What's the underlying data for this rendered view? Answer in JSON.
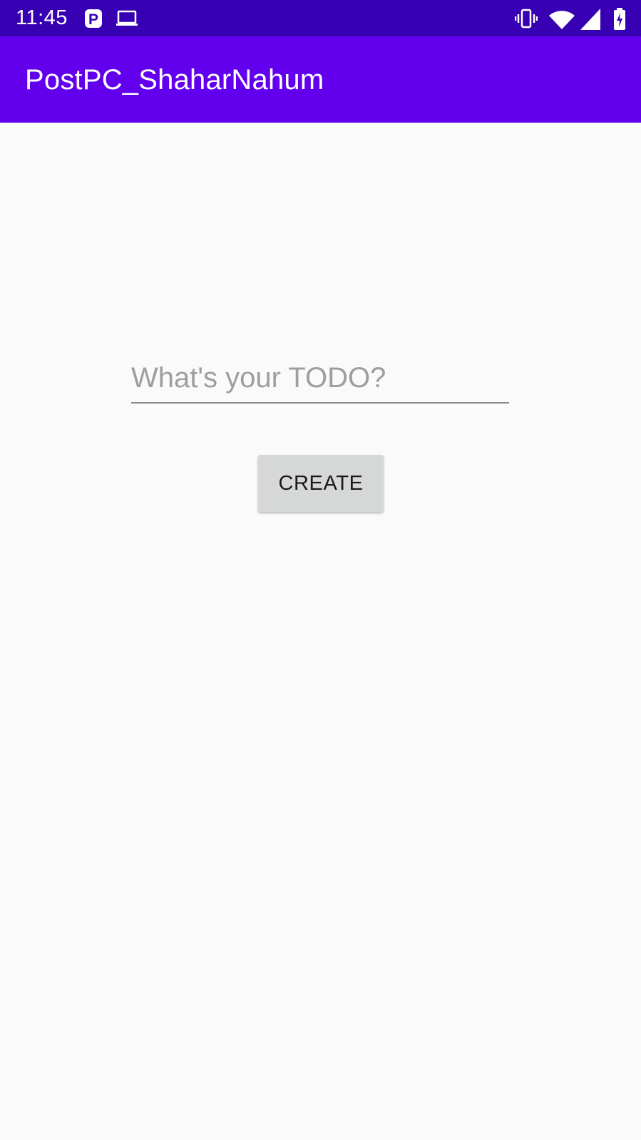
{
  "status_bar": {
    "time": "11:45",
    "icons": [
      "parking-icon",
      "laptop-icon",
      "vibrate-icon",
      "wifi-icon",
      "signal-icon",
      "battery-charging-icon"
    ]
  },
  "app_bar": {
    "title": "PostPC_ShaharNahum"
  },
  "main": {
    "todo_input": {
      "value": "",
      "placeholder": "What's your TODO?"
    },
    "create_label": "CREATE"
  },
  "colors": {
    "status_bar": "#3700b3",
    "app_bar": "#6200ee",
    "background": "#fafafa",
    "button": "#d6d7d7"
  }
}
